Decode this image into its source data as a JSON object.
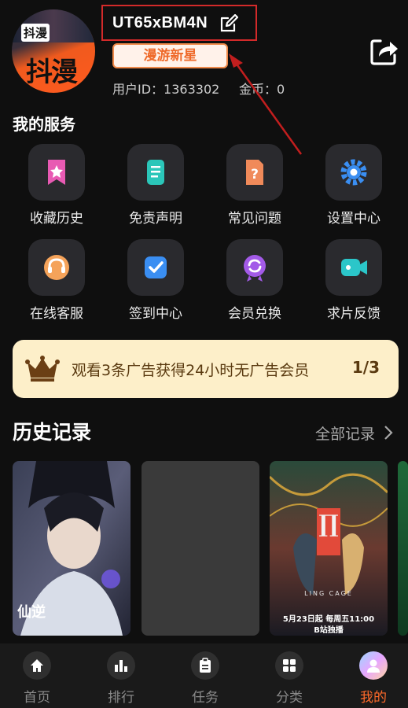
{
  "profile": {
    "avatar_text_top": "抖漫",
    "avatar_text_main": "抖漫",
    "username": "UT65xBM4N",
    "level_badge": "漫游新星",
    "user_id_label": "用户ID：",
    "user_id": "1363302",
    "coins_label": "金币：",
    "coins": "0"
  },
  "services": {
    "title": "我的服务",
    "items": [
      {
        "label": "收藏历史",
        "icon": "bookmark-star-icon",
        "color": "#e85ab3"
      },
      {
        "label": "免责声明",
        "icon": "document-icon",
        "color": "#2bc6b9"
      },
      {
        "label": "常见问题",
        "icon": "question-doc-icon",
        "color": "#f08a5a"
      },
      {
        "label": "设置中心",
        "icon": "gear-icon",
        "color": "#3a8ef2"
      },
      {
        "label": "在线客服",
        "icon": "headset-icon",
        "color": "#f5a35a"
      },
      {
        "label": "签到中心",
        "icon": "checkin-icon",
        "color": "#3a8ef2"
      },
      {
        "label": "会员兑换",
        "icon": "exchange-badge-icon",
        "color": "#a35ae8"
      },
      {
        "label": "求片反馈",
        "icon": "video-feedback-icon",
        "color": "#2bc6c9"
      }
    ]
  },
  "ad_banner": {
    "text": "观看3条广告获得24小时无广告会员",
    "progress": "1/3",
    "icon": "crown-icon"
  },
  "history": {
    "title": "历史记录",
    "all_link": "全部记录",
    "cards": [
      {
        "caption": "仙逆"
      },
      {
        "caption": ""
      },
      {
        "caption": "5月23日起 每周五11:00",
        "caption2": "B站独播",
        "top_text": "LING CAGE"
      },
      {
        "caption": ""
      }
    ]
  },
  "tabbar": {
    "tabs": [
      {
        "label": "首页",
        "icon": "home-icon",
        "active": false
      },
      {
        "label": "排行",
        "icon": "bar-chart-icon",
        "active": false
      },
      {
        "label": "任务",
        "icon": "clipboard-icon",
        "active": false
      },
      {
        "label": "分类",
        "icon": "grid-icon",
        "active": false
      },
      {
        "label": "我的",
        "icon": "avatar-icon",
        "active": true
      }
    ]
  },
  "colors": {
    "accent": "#ff6a2a",
    "annotation_red": "#d32a2a",
    "banner_bg": "#fdefc9"
  }
}
